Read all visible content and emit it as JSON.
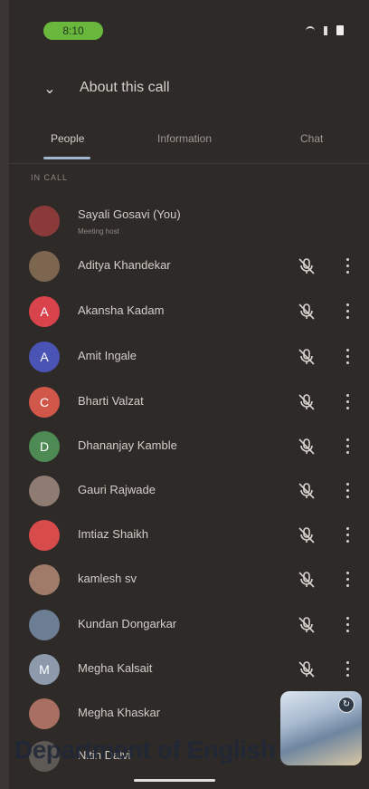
{
  "status_bar": {
    "time": "8:10"
  },
  "header": {
    "title": "About this call"
  },
  "tabs": [
    {
      "label": "People"
    },
    {
      "label": "Information"
    },
    {
      "label": "Chat"
    }
  ],
  "section_label": "IN CALL",
  "participants": [
    {
      "name": "Sayali Gosavi (You)",
      "subtitle": "Meeting host",
      "avatar_letter": "",
      "avatar_color": "#8b3a3a"
    },
    {
      "name": "Aditya Khandekar",
      "avatar_letter": "",
      "avatar_color": "#7d6650"
    },
    {
      "name": "Akansha Kadam",
      "avatar_letter": "A",
      "avatar_color": "#d9434b"
    },
    {
      "name": "Amit Ingale",
      "avatar_letter": "A",
      "avatar_color": "#4a54b5"
    },
    {
      "name": "Bharti Valzat",
      "avatar_letter": "C",
      "avatar_color": "#d1574b"
    },
    {
      "name": "Dhananjay Kamble",
      "avatar_letter": "D",
      "avatar_color": "#4d8a54"
    },
    {
      "name": "Gauri Rajwade",
      "avatar_letter": "",
      "avatar_color": "#8e7b72"
    },
    {
      "name": "Imtiaz Shaikh",
      "avatar_letter": "",
      "avatar_color": "#d84b4b"
    },
    {
      "name": "kamlesh sv",
      "avatar_letter": "",
      "avatar_color": "#a07b6a"
    },
    {
      "name": "Kundan Dongarkar",
      "avatar_letter": "",
      "avatar_color": "#6b7e94"
    },
    {
      "name": "Megha Kalsait",
      "avatar_letter": "M",
      "avatar_color": "#8c9aac"
    },
    {
      "name": "Megha Khaskar",
      "avatar_letter": "",
      "avatar_color": "#a86f62"
    },
    {
      "name": "Nitin Dalvi",
      "avatar_letter": "",
      "avatar_color": "#5d5955"
    }
  ],
  "watermark": "Department of English",
  "colors": {
    "accent": "#a0b7cf",
    "background": "#2e2a28",
    "time_pill": "#69b83d"
  }
}
